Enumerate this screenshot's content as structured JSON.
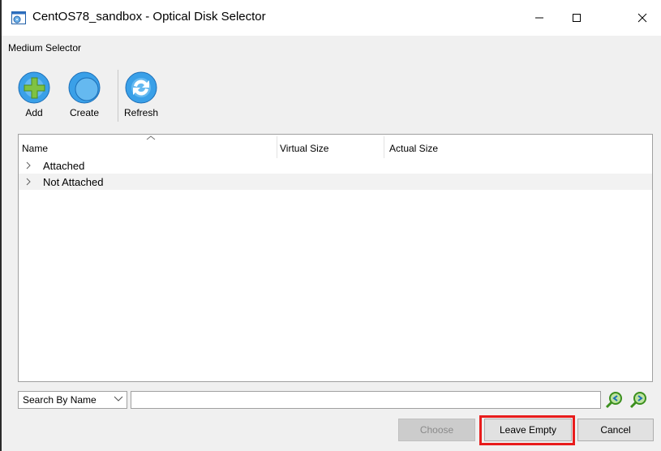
{
  "window": {
    "title": "CentOS78_sandbox - Optical Disk Selector",
    "controls": [
      "minimize",
      "maximize",
      "close"
    ]
  },
  "section_label": "Medium Selector",
  "toolbar": {
    "items": [
      {
        "label": "Add",
        "icon": "add-disk-icon"
      },
      {
        "label": "Create",
        "icon": "create-disk-icon"
      },
      {
        "label": "Refresh",
        "icon": "refresh-icon"
      }
    ]
  },
  "tree": {
    "columns": [
      "Name",
      "Virtual Size",
      "Actual Size"
    ],
    "sorted_column": "Name",
    "rows": [
      {
        "label": "Attached",
        "expanded": false
      },
      {
        "label": "Not Attached",
        "expanded": false
      }
    ]
  },
  "search": {
    "mode": "Search By Name",
    "value": ""
  },
  "buttons": {
    "choose": "Choose",
    "leave_empty": "Leave Empty",
    "cancel": "Cancel"
  },
  "colors": {
    "highlight": "#e81c1c",
    "icon_blue": "#3aa0e8",
    "icon_green": "#7fc243"
  }
}
